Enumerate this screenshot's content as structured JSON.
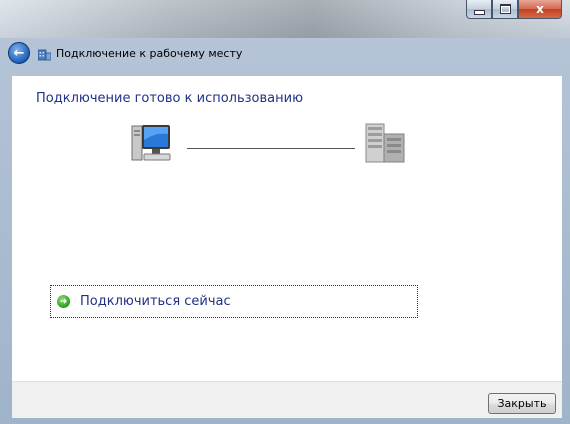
{
  "window": {
    "title": "Подключение к рабочему месту",
    "buttons": {
      "minimize_icon": "minimize-icon",
      "maximize_icon": "maximize-icon",
      "close_glyph": "x"
    }
  },
  "nav": {
    "back_icon": "back-arrow-icon",
    "app_icon": "workplace-connection-icon"
  },
  "main": {
    "heading": "Подключение готово к использованию",
    "diagram": {
      "left_icon": "computer-icon",
      "right_icon": "server-icon"
    },
    "connect_option": {
      "icon": "green-arrow-icon",
      "label": "Подключиться сейчас",
      "accelerator": "с"
    }
  },
  "footer": {
    "close_label": "Закрыть",
    "close_accelerator": "З"
  },
  "colors": {
    "link_blue": "#1e3287",
    "close_red": "#c2401f",
    "footer_bg": "#f0f0f0"
  }
}
